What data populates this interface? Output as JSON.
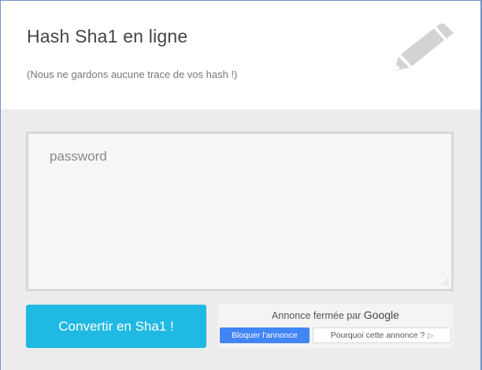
{
  "header": {
    "title": "Hash Sha1 en ligne",
    "subtitle": "(Nous ne gardons aucune trace de vos hash !)",
    "icon": "pencil-icon"
  },
  "form": {
    "input_placeholder": "password",
    "input_value": "",
    "submit_label": "Convertir en Sha1 !"
  },
  "ad": {
    "closed_text": "Annonce fermée par",
    "provider": "Google",
    "block_label": "Bloquer l'annonce",
    "why_label": "Pourquoi cette annonce ?",
    "why_icon": "ad-choices-icon"
  },
  "colors": {
    "accent": "#20b9e3",
    "ad_button": "#4285f4",
    "background": "#ececec",
    "header_bg": "#ffffff"
  }
}
